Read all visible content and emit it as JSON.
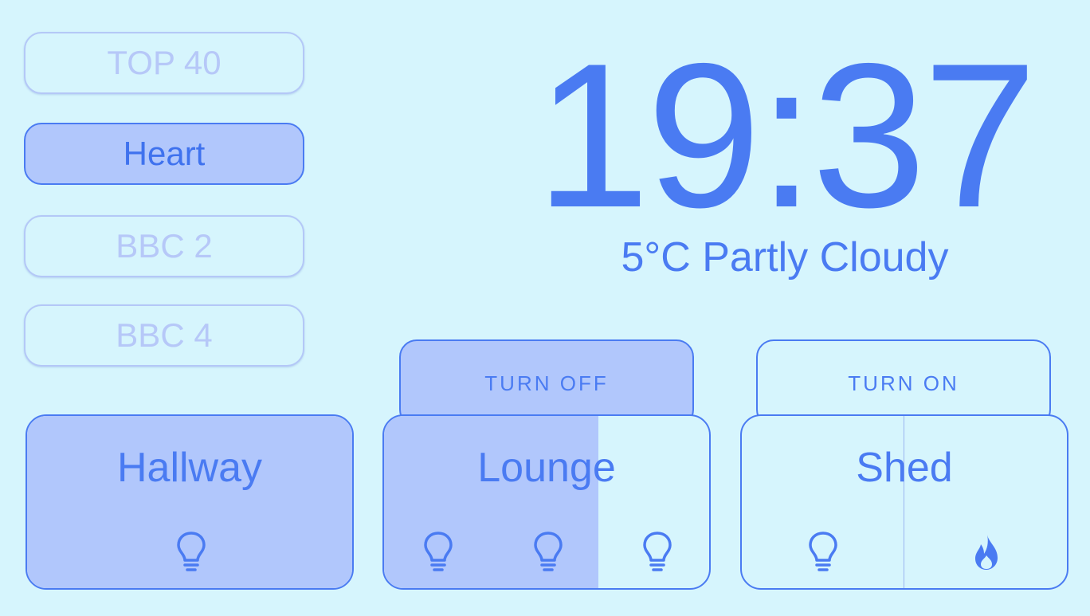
{
  "stations": [
    {
      "label": "TOP 40",
      "active": false
    },
    {
      "label": "Heart",
      "active": true
    },
    {
      "label": "BBC 2",
      "active": false
    },
    {
      "label": "BBC 4",
      "active": false
    }
  ],
  "clock": {
    "time": "19:37",
    "weather": "5°C Partly Cloudy"
  },
  "rooms": [
    {
      "name": "Hallway",
      "level": 1.0,
      "icons": [
        "light-bulb-icon"
      ]
    },
    {
      "name": "Lounge",
      "level": 0.66,
      "action": "TURN OFF",
      "icons": [
        "light-bulb-icon",
        "light-bulb-icon",
        "light-bulb-icon"
      ]
    },
    {
      "name": "Shed",
      "level": 0.0,
      "action": "TURN ON",
      "icons": [
        "light-bulb-icon",
        "flame-icon"
      ]
    }
  ],
  "colors": {
    "accent": "#4a7bf2",
    "fill": "#b1c7fc",
    "background": "#d6f5fd",
    "inactive_text": "#b6c8f8"
  }
}
